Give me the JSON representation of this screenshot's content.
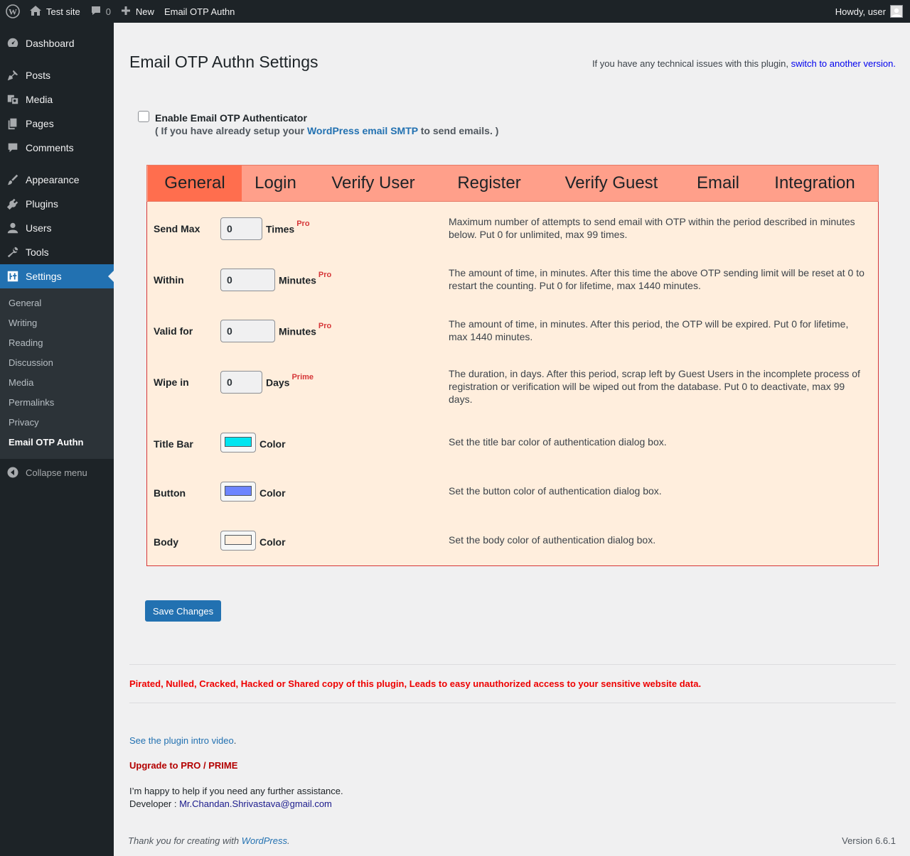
{
  "adminbar": {
    "site_name": "Test site",
    "comments_count": "0",
    "new_label": "New",
    "plugin_label": "Email OTP Authn",
    "howdy": "Howdy, user"
  },
  "sidebar": {
    "items": [
      {
        "label": "Dashboard",
        "icon": "dashboard-icon"
      },
      {
        "label": "Posts",
        "icon": "pin-icon"
      },
      {
        "label": "Media",
        "icon": "media-icon"
      },
      {
        "label": "Pages",
        "icon": "pages-icon"
      },
      {
        "label": "Comments",
        "icon": "comment-icon"
      },
      {
        "label": "Appearance",
        "icon": "brush-icon"
      },
      {
        "label": "Plugins",
        "icon": "plug-icon"
      },
      {
        "label": "Users",
        "icon": "user-icon"
      },
      {
        "label": "Tools",
        "icon": "wrench-icon"
      },
      {
        "label": "Settings",
        "icon": "settings-icon"
      }
    ],
    "submenu": [
      "General",
      "Writing",
      "Reading",
      "Discussion",
      "Media",
      "Permalinks",
      "Privacy",
      "Email OTP Authn"
    ],
    "collapse": "Collapse menu"
  },
  "page": {
    "title": "Email OTP Authn Settings",
    "tech_note": "If you have any technical issues with this plugin, ",
    "tech_link": "switch to another version.",
    "enable_label": "Enable Email OTP Authenticator",
    "enable_note_pre": "( If you have already setup your ",
    "enable_note_link": "WordPress email SMTP",
    "enable_note_post": " to send emails. )"
  },
  "tabs": [
    "General",
    "Login",
    "Verify User",
    "Register",
    "Verify Guest",
    "Email",
    "Integration"
  ],
  "settings": [
    {
      "label": "Send Max",
      "value": "0",
      "unit": "Times",
      "tier": "Pro",
      "desc": "Maximum number of attempts to send email with OTP within the period described in minutes below. Put 0 for unlimited, max 99 times."
    },
    {
      "label": "Within",
      "value": "0",
      "unit": "Minutes",
      "tier": "Pro",
      "desc": "The amount of time, in minutes. After this time the above OTP sending limit will be reset at 0 to restart the counting. Put 0 for lifetime, max 1440 minutes."
    },
    {
      "label": "Valid for",
      "value": "0",
      "unit": "Minutes",
      "tier": "Pro",
      "desc": "The amount of time, in minutes. After this period, the OTP will be expired. Put 0 for lifetime, max 1440 minutes."
    },
    {
      "label": "Wipe in",
      "value": "0",
      "unit": "Days",
      "tier": "Prime",
      "desc": "The duration, in days. After this period, scrap left by Guest Users in the incomplete process of registration or verification will be wiped out from the database. Put 0 to deactivate, max 99 days."
    }
  ],
  "colors": [
    {
      "label": "Title Bar",
      "unit": "Color",
      "color": "#00e5f0",
      "desc": "Set the title bar color of authentication dialog box."
    },
    {
      "label": "Button",
      "unit": "Color",
      "color": "#6d85ff",
      "desc": "Set the button color of authentication dialog box."
    },
    {
      "label": "Body",
      "unit": "Color",
      "color": "#ffeedd",
      "desc": "Set the body color of authentication dialog box."
    }
  ],
  "save_label": "Save Changes",
  "footer": {
    "warning": "Pirated, Nulled, Cracked, Hacked or Shared copy of this plugin, Leads to easy unauthorized access to your sensitive website data.",
    "intro_link": "See the plugin intro video",
    "intro_after": ".",
    "upgrade": "Upgrade to PRO / PRIME",
    "help": "I’m happy to help if you need any further assistance.",
    "developer_label": "Developer : ",
    "developer_email": "Mr.Chandan.Shrivastava@gmail.com",
    "thanks_pre": "Thank you for creating with ",
    "thanks_link": "WordPress",
    "thanks_post": ".",
    "version": "Version 6.6.1"
  }
}
